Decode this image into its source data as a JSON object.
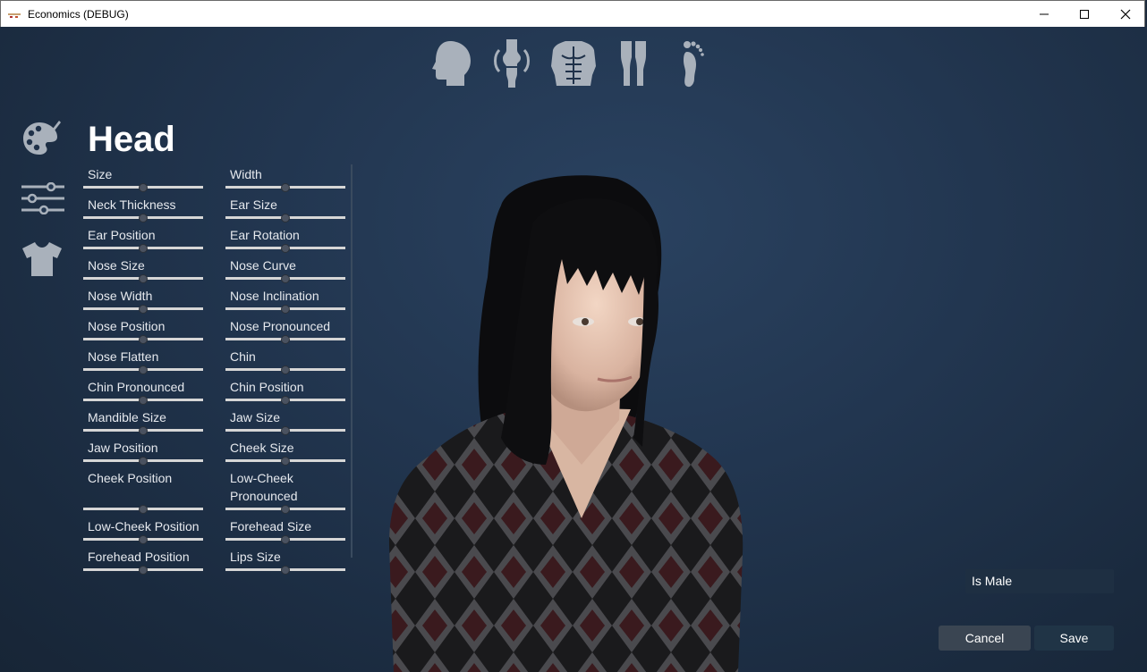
{
  "window": {
    "title": "Economics (DEBUG)",
    "controls": [
      "minimize-icon",
      "maximize-icon",
      "close-icon"
    ]
  },
  "category_icons": [
    "head-icon",
    "joint-icon",
    "torso-icon",
    "legs-icon",
    "foot-icon"
  ],
  "side_icons": [
    "palette-icon",
    "sliders-icon",
    "tshirt-icon"
  ],
  "panel": {
    "title": "Head",
    "left_column": [
      {
        "label": "Size",
        "value": 0.5
      },
      {
        "label": "Neck Thickness",
        "value": 0.5
      },
      {
        "label": "Ear Position",
        "value": 0.5
      },
      {
        "label": "Nose Size",
        "value": 0.5
      },
      {
        "label": "Nose Width",
        "value": 0.5
      },
      {
        "label": "Nose Position",
        "value": 0.5
      },
      {
        "label": "Nose Flatten",
        "value": 0.5
      },
      {
        "label": "Chin Pronounced",
        "value": 0.5
      },
      {
        "label": "Mandible Size",
        "value": 0.5
      },
      {
        "label": "Jaw Position",
        "value": 0.5
      },
      {
        "label": "Cheek Position",
        "value": 0.5
      },
      {
        "label": "Low-Cheek Position",
        "value": 0.5
      },
      {
        "label": "Forehead Position",
        "value": 0.5
      }
    ],
    "right_column": [
      {
        "label": "Width",
        "value": 0.5
      },
      {
        "label": "Ear Size",
        "value": 0.5
      },
      {
        "label": "Ear Rotation",
        "value": 0.5
      },
      {
        "label": "Nose Curve",
        "value": 0.5
      },
      {
        "label": "Nose Inclination",
        "value": 0.5
      },
      {
        "label": "Nose Pronounced",
        "value": 0.5
      },
      {
        "label": "Chin",
        "value": 0.5
      },
      {
        "label": "Chin Position",
        "value": 0.5
      },
      {
        "label": "Jaw Size",
        "value": 0.5
      },
      {
        "label": "Cheek Size",
        "value": 0.5
      },
      {
        "label": "Low-Cheek Pronounced",
        "value": 0.5
      },
      {
        "label": "Forehead Size",
        "value": 0.5
      },
      {
        "label": "Lips Size",
        "value": 0.5
      }
    ]
  },
  "toggle": {
    "label": "Is Male",
    "on": false
  },
  "buttons": {
    "cancel": "Cancel",
    "save": "Save"
  },
  "colors": {
    "background": "#1b2a3c",
    "icon": "#a9b1bb",
    "text": "#e6e9ee",
    "cancel_bg": "#3a4552",
    "save_bg": "#203446"
  }
}
